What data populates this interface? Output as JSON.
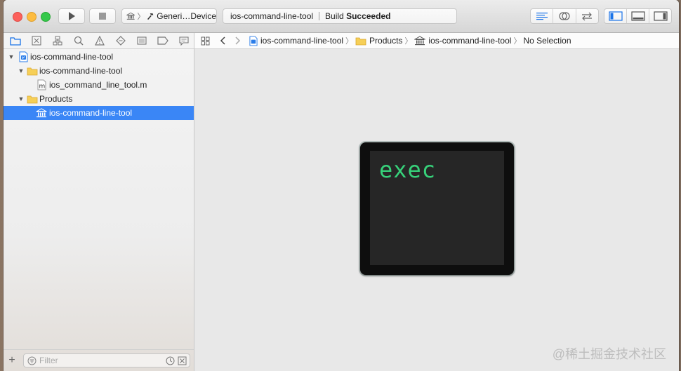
{
  "toolbar": {
    "scheme_text": "Generi…Device",
    "activity_project": "ios-command-line-tool",
    "build_prefix": "Build",
    "build_status": "Succeeded"
  },
  "navigator": {
    "tree": [
      {
        "label": "ios-command-line-tool",
        "icon": "project-icon",
        "level": 0,
        "expanded": true,
        "selected": false
      },
      {
        "label": "ios-command-line-tool",
        "icon": "folder-icon",
        "level": 1,
        "expanded": true,
        "selected": false
      },
      {
        "label": "ios_command_line_tool.m",
        "icon": "objc-file-icon",
        "level": 2,
        "expanded": null,
        "selected": false
      },
      {
        "label": "Products",
        "icon": "folder-icon",
        "level": 1,
        "expanded": true,
        "selected": false
      },
      {
        "label": "ios-command-line-tool",
        "icon": "executable-icon",
        "level": 2,
        "expanded": null,
        "selected": true
      }
    ],
    "filter_placeholder": "Filter"
  },
  "jumpbar": {
    "crumbs": [
      "ios-command-line-tool",
      "Products",
      "ios-command-line-tool",
      "No Selection"
    ]
  },
  "editor": {
    "preview_text": "exec",
    "preview_color": "#37d17a"
  },
  "watermark": "@稀土掘金技术社区",
  "colors": {
    "selection": "#3a86f6",
    "accent": "#1a73e8"
  }
}
